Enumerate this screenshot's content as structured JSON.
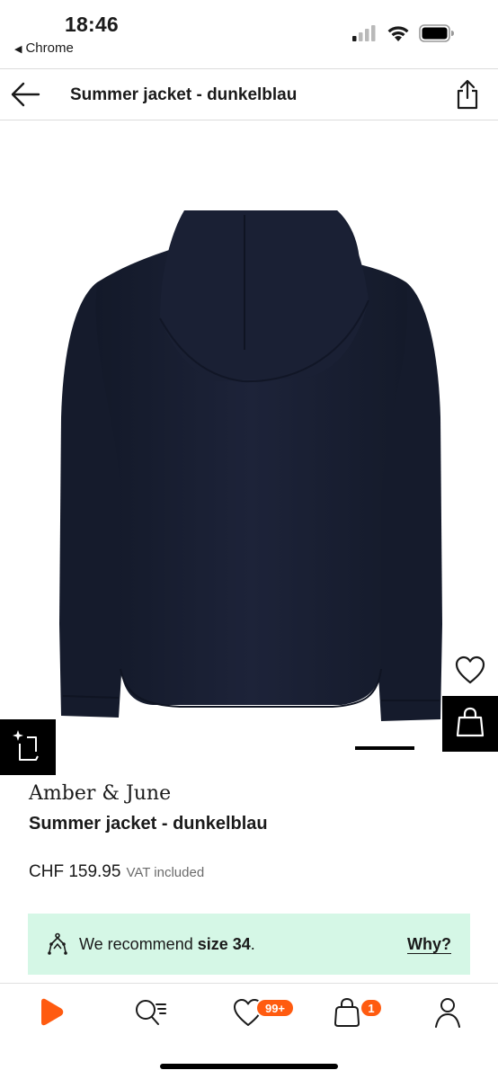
{
  "status_bar": {
    "time": "18:46",
    "back_app": "Chrome",
    "back_glyph": "◀"
  },
  "header": {
    "title": "Summer jacket - dunkelblau"
  },
  "product": {
    "brand": "Amber & June",
    "name": "Summer jacket - dunkelblau",
    "price": "CHF 159.95",
    "vat_note": "VAT included",
    "image_color": "#1b2137"
  },
  "size_recommendation": {
    "prefix": "We recommend ",
    "size": "size 34",
    "suffix": ".",
    "why_label": "Why?",
    "background": "#d5f7e6"
  },
  "bottom_nav": {
    "wishlist_badge": "99+",
    "cart_badge": "1",
    "accent_color": "#ff5b10"
  },
  "icons": [
    "back-arrow-icon",
    "share-icon",
    "heart-icon",
    "shopping-bag-icon",
    "ar-try-on-icon",
    "size-fit-icon",
    "home-play-icon",
    "search-list-icon",
    "wishlist-heart-icon",
    "cart-bag-icon",
    "profile-icon"
  ]
}
